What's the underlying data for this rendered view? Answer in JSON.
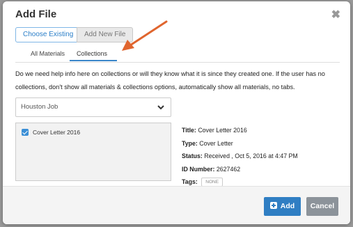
{
  "modal": {
    "title": "Add File",
    "close_icon": "close-icon"
  },
  "segmented": {
    "choose_existing": "Choose Existing",
    "add_new_file": "Add New File"
  },
  "tabs": {
    "all_materials": "All Materials",
    "collections": "Collections"
  },
  "help_text": "Do we need help info here on collections or will they know what it is since they created one. If the user has no collections, don't show all materials & collections options, automatically show all materials, no tabs.",
  "collection_select": {
    "selected": "Houston Job"
  },
  "files": [
    {
      "label": "Cover Letter 2016",
      "checked": true
    }
  ],
  "details": {
    "title_label": "Title:",
    "title_value": "Cover Letter 2016",
    "type_label": "Type:",
    "type_value": "Cover Letter",
    "status_label": "Status:",
    "status_value": "Received , Oct 5, 2016 at 4:47 PM",
    "id_label": "ID Number:",
    "id_value": "2627462",
    "tags_label": "Tags:",
    "tag_none": "NONE"
  },
  "footer": {
    "add_label": "Add",
    "cancel_label": "Cancel"
  },
  "colors": {
    "accent": "#2f7ec3",
    "annotation_arrow": "#e0652e"
  }
}
